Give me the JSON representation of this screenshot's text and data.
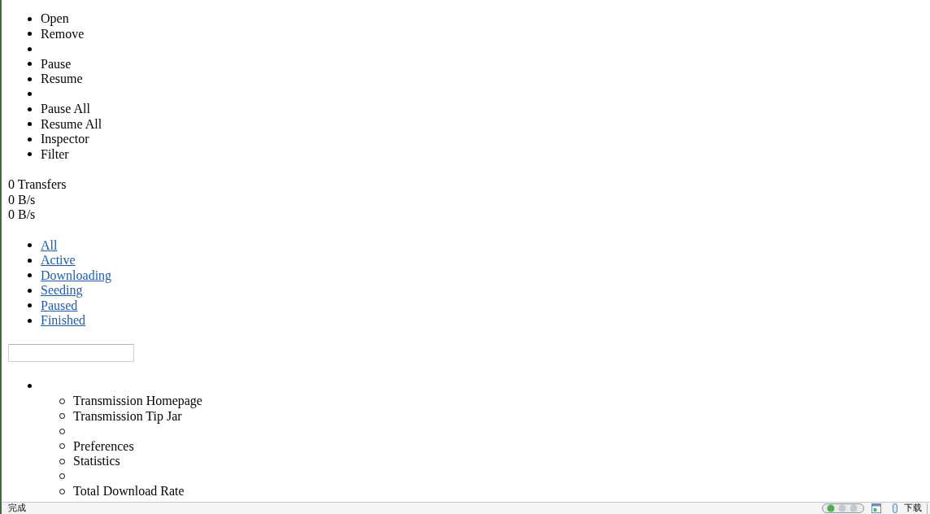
{
  "toolbar": [
    {
      "kind": "item",
      "label": "Open"
    },
    {
      "kind": "item",
      "label": "Remove"
    },
    {
      "kind": "separator"
    },
    {
      "kind": "item",
      "label": "Pause"
    },
    {
      "kind": "item",
      "label": "Resume"
    },
    {
      "kind": "separator"
    },
    {
      "kind": "item",
      "label": "Pause All"
    },
    {
      "kind": "item",
      "label": "Resume All"
    },
    {
      "kind": "item",
      "label": "Inspector"
    },
    {
      "kind": "item",
      "label": "Filter"
    }
  ],
  "stats": [
    "0 Transfers",
    "0 B/s",
    "0 B/s"
  ],
  "filters": [
    {
      "label": "All"
    },
    {
      "label": "Active"
    },
    {
      "label": "Downloading"
    },
    {
      "label": "Seeding"
    },
    {
      "label": "Paused"
    },
    {
      "label": "Finished"
    }
  ],
  "settings_menu": [
    {
      "children": [
        {
          "kind": "item",
          "label": "Transmission Homepage"
        },
        {
          "kind": "item",
          "label": "Transmission Tip Jar"
        },
        {
          "kind": "separator"
        },
        {
          "kind": "item",
          "label": "Preferences"
        },
        {
          "kind": "item",
          "label": "Statistics"
        },
        {
          "kind": "separator"
        },
        {
          "kind": "item",
          "label": "Total Download Rate"
        }
      ]
    }
  ],
  "status_bar": {
    "status": "完成",
    "download_label": "下载"
  }
}
